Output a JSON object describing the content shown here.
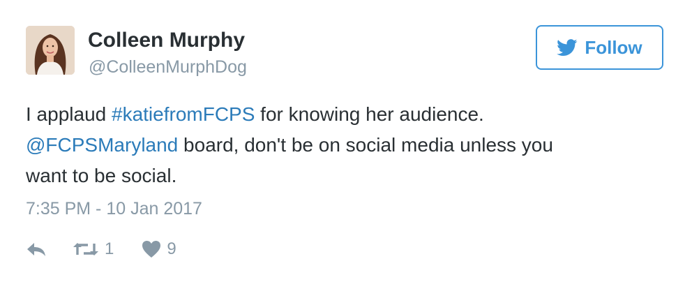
{
  "author": {
    "name": "Colleen Murphy",
    "handle": "@ColleenMurphDog",
    "avatar_icon": "profile-photo"
  },
  "follow_button": {
    "label": "Follow",
    "icon": "twitter-bird-icon"
  },
  "tweet": {
    "lines": [
      {
        "pre": "I applaud ",
        "link": "#katiefromFCPS",
        "post": " for knowing her audience."
      },
      {
        "pre": "",
        "link": "@FCPSMaryland",
        "post": " board, don't be on social media unless you"
      },
      {
        "pre": "want to be social.",
        "link": "",
        "post": ""
      }
    ],
    "timestamp": "7:35 PM - 10 Jan 2017"
  },
  "actions": {
    "reply_icon": "reply-icon",
    "retweet_icon": "retweet-icon",
    "retweet_count": "1",
    "like_icon": "heart-icon",
    "like_count": "9"
  },
  "colors": {
    "link": "#2b7bb9",
    "follow_accent": "#3b94d9",
    "muted": "#8899a6",
    "text": "#292f33"
  }
}
